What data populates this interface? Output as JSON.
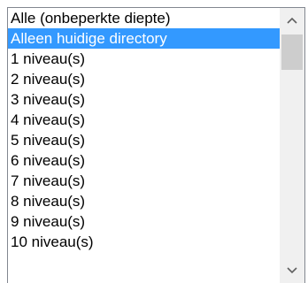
{
  "listbox": {
    "selected_index": 1,
    "items": [
      "Alle (onbeperkte diepte)",
      "Alleen huidige directory",
      "1 niveau(s)",
      "2 niveau(s)",
      "3 niveau(s)",
      "4 niveau(s)",
      "5 niveau(s)",
      "6 niveau(s)",
      "7 niveau(s)",
      "8 niveau(s)",
      "9 niveau(s)",
      "10 niveau(s)"
    ]
  },
  "scrollbar": {
    "up_icon": "chevron-up-icon",
    "down_icon": "chevron-down-icon",
    "position": 0
  },
  "colors": {
    "selection": "#3399ff",
    "selection_text": "#ffffff",
    "border": "#828790",
    "scroll_track": "#f0f0f0",
    "scroll_thumb": "#cdcdcd"
  }
}
